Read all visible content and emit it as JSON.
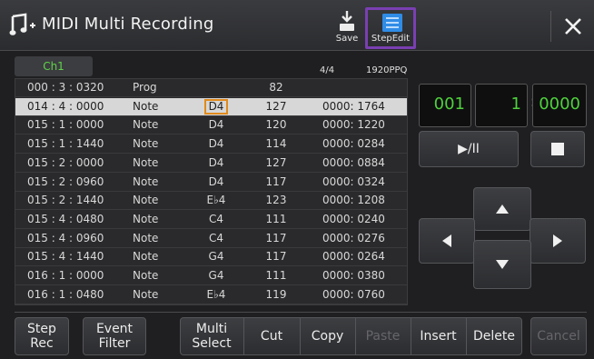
{
  "header": {
    "title": "MIDI Multi Recording",
    "save_label": "Save",
    "stepedit_label": "StepEdit"
  },
  "channel_tab": "Ch1",
  "time_signature": "4/4",
  "resolution": "1920PPQ",
  "events": [
    {
      "time": "000 : 3 : 0320",
      "type": "Prog",
      "note": "",
      "value": "82",
      "length": ""
    },
    {
      "time": "014 : 4 : 0000",
      "type": "Note",
      "note": "D4",
      "value": "127",
      "length": "0000: 1764"
    },
    {
      "time": "015 : 1 : 0000",
      "type": "Note",
      "note": "D4",
      "value": "120",
      "length": "0000: 1220"
    },
    {
      "time": "015 : 1 : 1440",
      "type": "Note",
      "note": "D4",
      "value": "114",
      "length": "0000: 0284"
    },
    {
      "time": "015 : 2 : 0000",
      "type": "Note",
      "note": "D4",
      "value": "127",
      "length": "0000: 0884"
    },
    {
      "time": "015 : 2 : 0960",
      "type": "Note",
      "note": "D4",
      "value": "117",
      "length": "0000: 0324"
    },
    {
      "time": "015 : 2 : 1440",
      "type": "Note",
      "note": "E♭4",
      "value": "123",
      "length": "0000: 1208"
    },
    {
      "time": "015 : 4 : 0480",
      "type": "Note",
      "note": "C4",
      "value": "111",
      "length": "0000: 0240"
    },
    {
      "time": "015 : 4 : 0960",
      "type": "Note",
      "note": "C4",
      "value": "117",
      "length": "0000: 0276"
    },
    {
      "time": "015 : 4 : 1440",
      "type": "Note",
      "note": "G4",
      "value": "117",
      "length": "0000: 0264"
    },
    {
      "time": "016 : 1 : 0000",
      "type": "Note",
      "note": "G4",
      "value": "111",
      "length": "0000: 0380"
    },
    {
      "time": "016 : 1 : 0480",
      "type": "Note",
      "note": "E♭4",
      "value": "119",
      "length": "0000: 0760"
    }
  ],
  "selected_row": 1,
  "position": {
    "measure": "001",
    "beat": "1",
    "clock": "0000",
    "sep": ":"
  },
  "transport": {
    "play_pause_label": "▶/II"
  },
  "bottom_buttons": {
    "step_rec": "Step\nRec",
    "event_filter": "Event\nFilter",
    "multi_select": "Multi\nSelect",
    "cut": "Cut",
    "copy": "Copy",
    "paste": "Paste",
    "insert": "Insert",
    "delete": "Delete",
    "cancel": "Cancel"
  },
  "colors": {
    "accent_green": "#4fd23c",
    "highlight_purple": "#7a3fb2",
    "selection_orange": "#e08a1c"
  },
  "icons": [
    "music-note-icon",
    "save-icon",
    "stepedit-icon",
    "close-icon",
    "stop-icon",
    "arrow-up-icon",
    "arrow-down-icon",
    "arrow-left-icon",
    "arrow-right-icon"
  ]
}
